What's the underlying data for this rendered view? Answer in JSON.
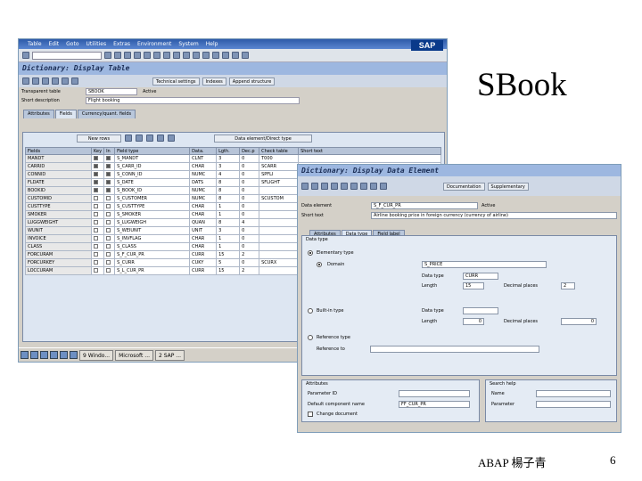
{
  "slide": {
    "title": "SBook",
    "footer": "ABAP  楊子青",
    "page": "6"
  },
  "window1": {
    "menu": [
      "Table",
      "Edit",
      "Goto",
      "Utilities",
      "Extras",
      "Environment",
      "System",
      "Help"
    ],
    "logo": "SAP",
    "title": "Dictionary: Display Table",
    "app_buttons": [
      "Technical settings",
      "Indexes",
      "Append structure"
    ],
    "header": {
      "table_label": "Transparent table",
      "table_value": "SBOOK",
      "status": "Active",
      "desc_label": "Short description",
      "desc_value": "Flight booking"
    },
    "tabs": [
      "Attributes",
      "Fields",
      "Currency/quant. fields"
    ],
    "table_buttons": [
      "New rows",
      "Data element/Direct type"
    ],
    "columns": [
      "Fields",
      "Key",
      "In",
      "Field type",
      "Data.",
      "Lgth.",
      "Dec.p",
      "Check table",
      "Short text"
    ],
    "rows": [
      {
        "field": "MANDT",
        "key": true,
        "in": true,
        "type": "S_MANDT",
        "dt": "CLNT",
        "len": "3",
        "dec": "0",
        "check": "T000"
      },
      {
        "field": "CARRID",
        "key": true,
        "in": true,
        "type": "S_CARR_ID",
        "dt": "CHAR",
        "len": "3",
        "dec": "0",
        "check": "SCARR"
      },
      {
        "field": "CONNID",
        "key": true,
        "in": true,
        "type": "S_CONN_ID",
        "dt": "NUMC",
        "len": "4",
        "dec": "0",
        "check": "SPFLI"
      },
      {
        "field": "FLDATE",
        "key": true,
        "in": true,
        "type": "S_DATE",
        "dt": "DATS",
        "len": "8",
        "dec": "0",
        "check": "SFLIGHT"
      },
      {
        "field": "BOOKID",
        "key": true,
        "in": true,
        "type": "S_BOOK_ID",
        "dt": "NUMC",
        "len": "8",
        "dec": "0",
        "check": ""
      },
      {
        "field": "CUSTOMID",
        "key": false,
        "in": false,
        "type": "S_CUSTOMER",
        "dt": "NUMC",
        "len": "8",
        "dec": "0",
        "check": "SCUSTOM"
      },
      {
        "field": "CUSTTYPE",
        "key": false,
        "in": false,
        "type": "S_CUSTTYPE",
        "dt": "CHAR",
        "len": "1",
        "dec": "0",
        "check": ""
      },
      {
        "field": "SMOKER",
        "key": false,
        "in": false,
        "type": "S_SMOKER",
        "dt": "CHAR",
        "len": "1",
        "dec": "0",
        "check": ""
      },
      {
        "field": "LUGGWEIGHT",
        "key": false,
        "in": false,
        "type": "S_LUGWEIGH",
        "dt": "QUAN",
        "len": "8",
        "dec": "4",
        "check": ""
      },
      {
        "field": "WUNIT",
        "key": false,
        "in": false,
        "type": "S_WEIUNIT",
        "dt": "UNIT",
        "len": "3",
        "dec": "0",
        "check": ""
      },
      {
        "field": "INVOICE",
        "key": false,
        "in": false,
        "type": "S_INVFLAG",
        "dt": "CHAR",
        "len": "1",
        "dec": "0",
        "check": ""
      },
      {
        "field": "CLASS",
        "key": false,
        "in": false,
        "type": "S_CLASS",
        "dt": "CHAR",
        "len": "1",
        "dec": "0",
        "check": ""
      },
      {
        "field": "FORCURAM",
        "key": false,
        "in": false,
        "type": "S_F_CUR_PR",
        "dt": "CURR",
        "len": "15",
        "dec": "2",
        "check": ""
      },
      {
        "field": "FORCURKEY",
        "key": false,
        "in": false,
        "type": "S_CURR",
        "dt": "CUKY",
        "len": "5",
        "dec": "0",
        "check": "SCURX"
      },
      {
        "field": "LOCCURAM",
        "key": false,
        "in": false,
        "type": "S_L_CUR_PR",
        "dt": "CURR",
        "len": "15",
        "dec": "2",
        "check": ""
      }
    ],
    "taskbar": [
      "9 Windo...",
      "Microsoft ...",
      "2 SAP ..."
    ]
  },
  "window2": {
    "title": "Dictionary: Display Data Element",
    "app_buttons": [
      "Documentation",
      "Supplementary"
    ],
    "de_label": "Data element",
    "de_value": "S_F_CUR_PR",
    "de_status": "Active",
    "sd_label": "Short text",
    "sd_value": "Airline booking price in foreign currency (currency of airline)",
    "tabs": [
      "Attributes",
      "Data type",
      "Field label"
    ],
    "data_type_title": "Data type",
    "elem_type_label": "Elementary type",
    "domain_label": "Domain",
    "domain_value": "S_PRICE",
    "dtype_label": "Data type",
    "dtype_value": "CURR",
    "length_label": "Length",
    "length_value": "15",
    "dec_label": "Decimal places",
    "dec_value": "2",
    "builtin_label": "Built-in type",
    "builtin_dtype_label": "Data type",
    "builtin_len_label": "Length",
    "builtin_len_value": "0",
    "builtin_dec_label": "Decimal places",
    "builtin_dec_value": "0",
    "ref_label": "Reference type",
    "ref_name_label": "Reference to",
    "attributes_title": "Attributes",
    "param_label": "Parameter ID",
    "default_label": "Default component name",
    "default_value": "FF_CUR_PR",
    "change_doc_label": "Change document",
    "search_help_title": "Search help",
    "sh_name_label": "Name",
    "sh_param_label": "Parameter"
  }
}
